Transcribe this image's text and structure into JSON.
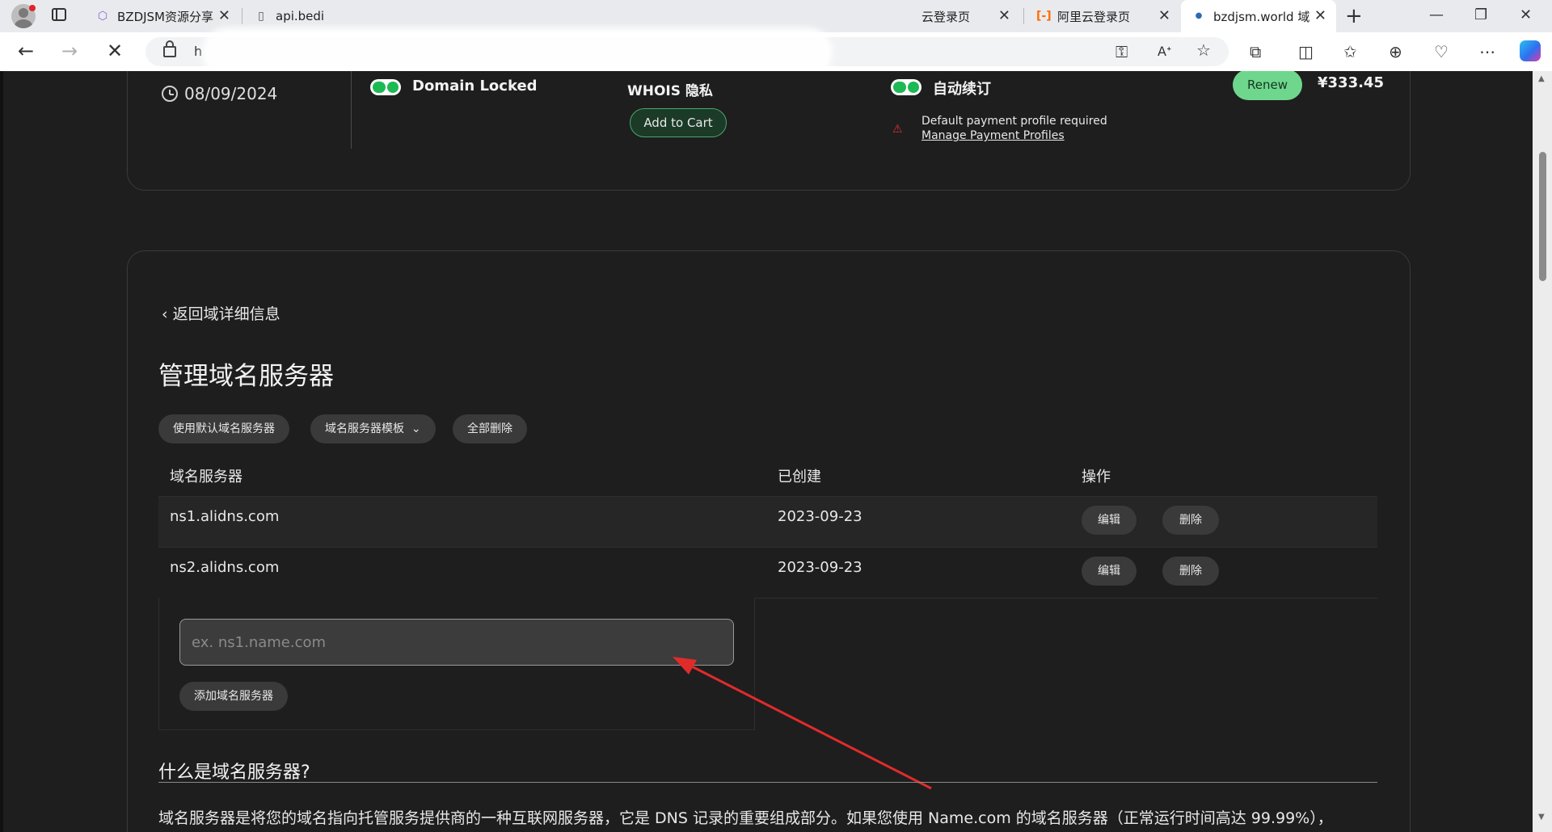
{
  "browser": {
    "tabs": [
      {
        "title": "BZDJSM资源分享"
      },
      {
        "title": "api.bedi"
      },
      {
        "title": "云登录页"
      },
      {
        "title": "阿里云登录页"
      },
      {
        "title": "bzdjsm.world 域"
      }
    ],
    "url": "h"
  },
  "domain_card": {
    "date": "08/09/2024",
    "domain_locked_label": "Domain Locked",
    "whois_label": "WHOIS 隐私",
    "add_to_cart": "Add to Cart",
    "auto_renew_label": "自动续订",
    "warning_text": "Default payment profile required",
    "manage_link": "Manage Payment Profiles",
    "renew_button": "Renew",
    "price": "¥333.45"
  },
  "ns_manager": {
    "back_link": "返回域详细信息",
    "title": "管理域名服务器",
    "actions": [
      "使用默认域名服务器",
      "域名服务器模板",
      "全部删除"
    ],
    "columns": [
      "域名服务器",
      "已创建",
      "操作"
    ],
    "rows": [
      {
        "server": "ns1.alidns.com",
        "created": "2023-09-23",
        "edit": "编辑",
        "delete": "删除"
      },
      {
        "server": "ns2.alidns.com",
        "created": "2023-09-23",
        "edit": "编辑",
        "delete": "删除"
      }
    ],
    "input_placeholder": "ex. ns1.name.com",
    "add_button": "添加域名服务器"
  },
  "faq": {
    "heading": "什么是域名服务器?",
    "paragraph": "域名服务器是将您的域名指向托管服务提供商的一种互联网服务器，它是 DNS 记录的重要组成部分。如果您使用 Name.com 的域名服务器（正常运行时间高达 99.99%），"
  }
}
